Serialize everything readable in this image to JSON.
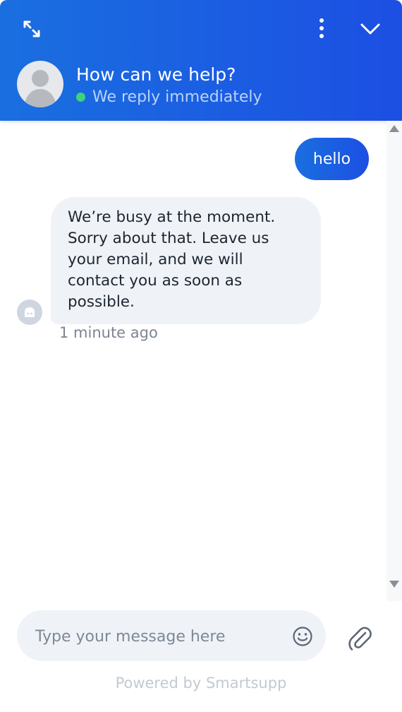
{
  "header": {
    "title": "How can we help?",
    "status": "We reply immediately",
    "status_color": "#3fd27a",
    "icons": [
      "expand-icon",
      "more-vertical-icon",
      "chevron-down-icon"
    ]
  },
  "messages": {
    "outgoing": {
      "text": "hello"
    },
    "incoming": {
      "lines": [
        "We’re busy at the moment.",
        "Sorry about that. Leave us",
        "your email, and we will",
        "contact you as soon as",
        "possible."
      ],
      "time": "1 minute ago"
    }
  },
  "composer": {
    "placeholder": "Type your message here",
    "value": ""
  },
  "footer": {
    "powered_by": "Powered by Smartsupp"
  },
  "colors": {
    "accent": "#1c4fe3",
    "bubble_in": "#eff3f8"
  }
}
